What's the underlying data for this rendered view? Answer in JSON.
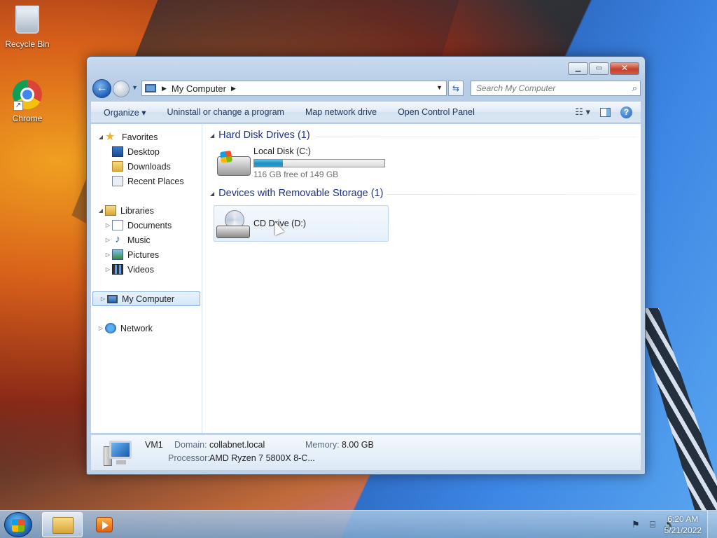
{
  "desktop": {
    "icons": [
      {
        "label": "Recycle Bin",
        "icon": "recycle-bin-icon"
      },
      {
        "label": "Chrome",
        "icon": "chrome-icon"
      }
    ]
  },
  "window": {
    "address": {
      "segments": [
        "My Computer"
      ],
      "icon": "computer-icon"
    },
    "search": {
      "placeholder": "Search My Computer"
    },
    "toolbar": {
      "organize": "Organize",
      "uninstall": "Uninstall or change a program",
      "map_drive": "Map network drive",
      "control_panel": "Open Control Panel"
    },
    "nav": {
      "favorites": "Favorites",
      "desktop": "Desktop",
      "downloads": "Downloads",
      "recent": "Recent Places",
      "libraries": "Libraries",
      "documents": "Documents",
      "music": "Music",
      "pictures": "Pictures",
      "videos": "Videos",
      "my_computer": "My Computer",
      "network": "Network"
    },
    "groups": {
      "hdd": {
        "title": "Hard Disk Drives (1)",
        "drive": {
          "name": "Local Disk (C:)",
          "free": "116 GB free of 149 GB",
          "used_fraction": 0.22
        }
      },
      "removable": {
        "title": "Devices with Removable Storage (1)",
        "drive": {
          "name": "CD Drive (D:)"
        }
      }
    },
    "details": {
      "name": "VM1",
      "domain_label": "Domain:",
      "domain_value": "collabnet.local",
      "memory_label": "Memory:",
      "memory_value": "8.00 GB",
      "processor_label": "Processor:",
      "processor_value": "AMD Ryzen 7 5800X 8-C..."
    }
  },
  "taskbar": {
    "time": "6:20 AM",
    "date": "5/21/2022"
  },
  "colors": {
    "accent": "#1e3287",
    "progress": "#1e8fc0"
  }
}
